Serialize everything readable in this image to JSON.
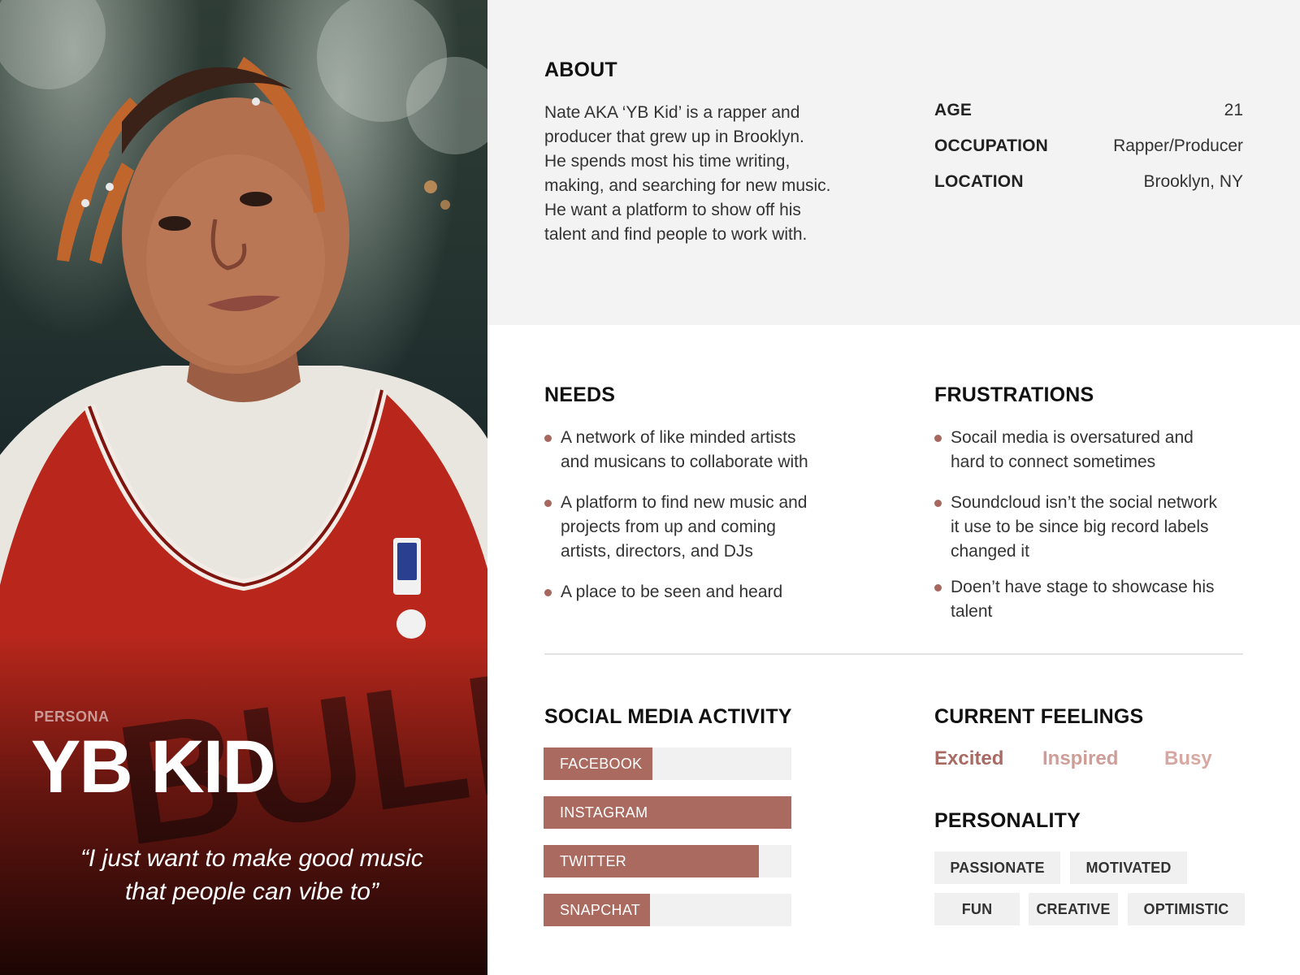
{
  "persona": {
    "label": "PERSONA",
    "name": "YB KID",
    "quote_line1": "“I just want to make good music",
    "quote_line2": "that people can vibe to”",
    "photo_icon": "portrait-photo"
  },
  "about": {
    "heading": "ABOUT",
    "lines": [
      "Nate AKA ‘YB Kid’ is a rapper and",
      "producer that grew up in Brooklyn.",
      "He spends most his time writing,",
      "making, and searching for new music.",
      "He want a platform to show off his",
      "talent and find people to work with."
    ],
    "stats": [
      {
        "key": "AGE",
        "value": "21"
      },
      {
        "key": "OCCUPATION",
        "value": "Rapper/Producer"
      },
      {
        "key": "LOCATION",
        "value": "Brooklyn, NY"
      }
    ]
  },
  "needs": {
    "heading": "NEEDS",
    "items": [
      {
        "line1": "A network of like minded artists",
        "line2": "and musicans to collaborate with",
        "line3": ""
      },
      {
        "line1": "A platform to find new music and",
        "line2": "projects from up and coming",
        "line3": "artists, directors, and DJs"
      },
      {
        "line1": "A place to be seen and heard",
        "line2": "",
        "line3": ""
      }
    ]
  },
  "frustrations": {
    "heading": "FRUSTRATIONS",
    "items": [
      {
        "line1": "Socail media is oversatured and",
        "line2": "hard to connect sometimes",
        "line3": ""
      },
      {
        "line1": "Soundcloud isn’t the social network",
        "line2": "it use to be since big record labels",
        "line3": "changed it"
      },
      {
        "line1": "Doen’t have stage to showcase his",
        "line2": "talent",
        "line3": ""
      }
    ]
  },
  "social": {
    "heading": "SOCIAL MEDIA ACTIVITY",
    "items": [
      {
        "label": "FACEBOOK",
        "level": 0.44
      },
      {
        "label": "INSTAGRAM",
        "level": 1.0
      },
      {
        "label": "TWITTER",
        "level": 0.87
      },
      {
        "label": "SNAPCHAT",
        "level": 0.43
      }
    ]
  },
  "feelings": {
    "heading": "CURRENT FEELINGS",
    "items": [
      {
        "label": "Excited",
        "color": "#a86a62"
      },
      {
        "label": "Inspired",
        "color": "#cf9d97"
      },
      {
        "label": "Busy",
        "color": "#d7a8a2"
      }
    ]
  },
  "personality": {
    "heading": "PERSONALITY",
    "tags": [
      "PASSIONATE",
      "MOTIVATED",
      "FUN",
      "CREATIVE",
      "OPTIMISTIC"
    ]
  },
  "colors": {
    "accent": "#ab6a60",
    "band": "#f3f3f4",
    "bar_track": "#f1f1f2"
  }
}
